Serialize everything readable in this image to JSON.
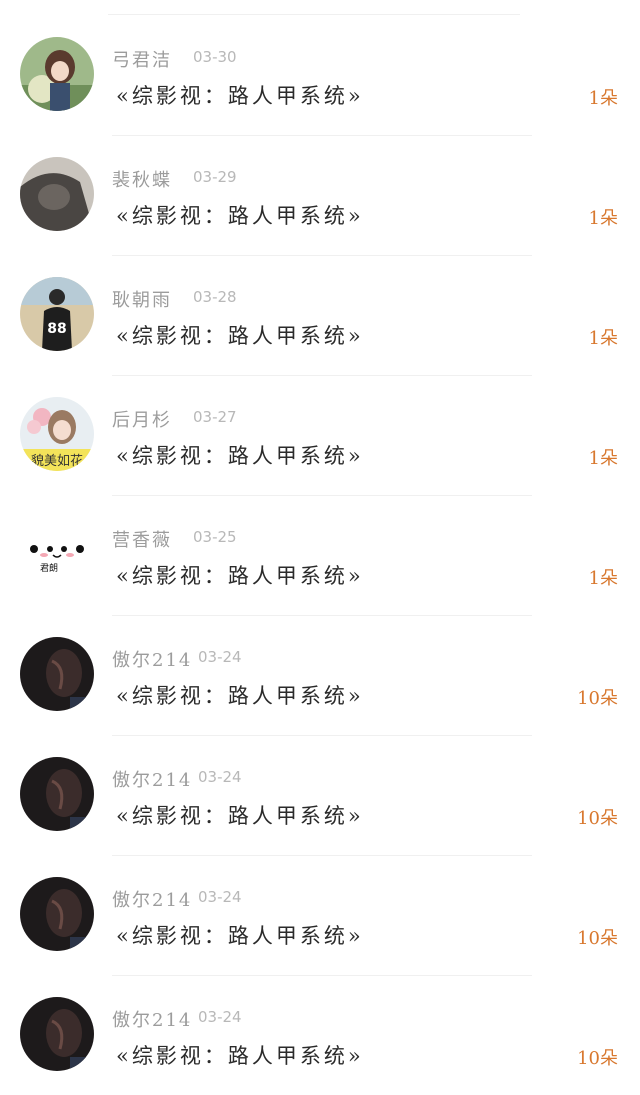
{
  "rows": [
    {
      "name": "弓君洁",
      "date": "03-30",
      "title": "«综影视：路人甲系统»",
      "count": "1朵"
    },
    {
      "name": "裴秋蝶",
      "date": "03-29",
      "title": "«综影视：路人甲系统»",
      "count": "1朵"
    },
    {
      "name": "耿朝雨",
      "date": "03-28",
      "title": "«综影视：路人甲系统»",
      "count": "1朵"
    },
    {
      "name": "后月杉",
      "date": "03-27",
      "title": "«综影视：路人甲系统»",
      "count": "1朵"
    },
    {
      "name": "营香薇",
      "date": "03-25",
      "title": "«综影视：路人甲系统»",
      "count": "1朵"
    },
    {
      "name": "傲尔214",
      "date": "03-24",
      "title": "«综影视：路人甲系统»",
      "count": "10朵"
    },
    {
      "name": "傲尔214",
      "date": "03-24",
      "title": "«综影视：路人甲系统»",
      "count": "10朵"
    },
    {
      "name": "傲尔214",
      "date": "03-24",
      "title": "«综影视：路人甲系统»",
      "count": "10朵"
    },
    {
      "name": "傲尔214",
      "date": "03-24",
      "title": "«综影视：路人甲系统»",
      "count": "10朵"
    }
  ],
  "avatars": {
    "row4_jersey_number": "88",
    "row5_banner_text": "貌美如花",
    "row6_badge_text": "君朗"
  }
}
